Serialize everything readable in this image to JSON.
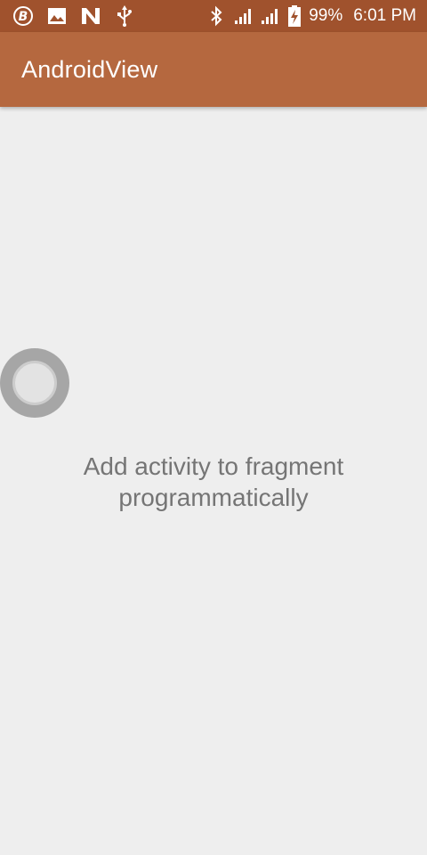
{
  "status_bar": {
    "battery": "99%",
    "time": "6:01 PM",
    "left_icons": [
      "b-badge-icon",
      "image-icon",
      "n-icon",
      "usb-icon"
    ],
    "right_icons": [
      "bluetooth-icon",
      "signal-icon",
      "signal-icon",
      "battery-icon"
    ]
  },
  "app_bar": {
    "title": "AndroidView",
    "color": "#b5683f"
  },
  "main": {
    "message_line1": "Add activity to fragment",
    "message_line2": "programmatically"
  }
}
